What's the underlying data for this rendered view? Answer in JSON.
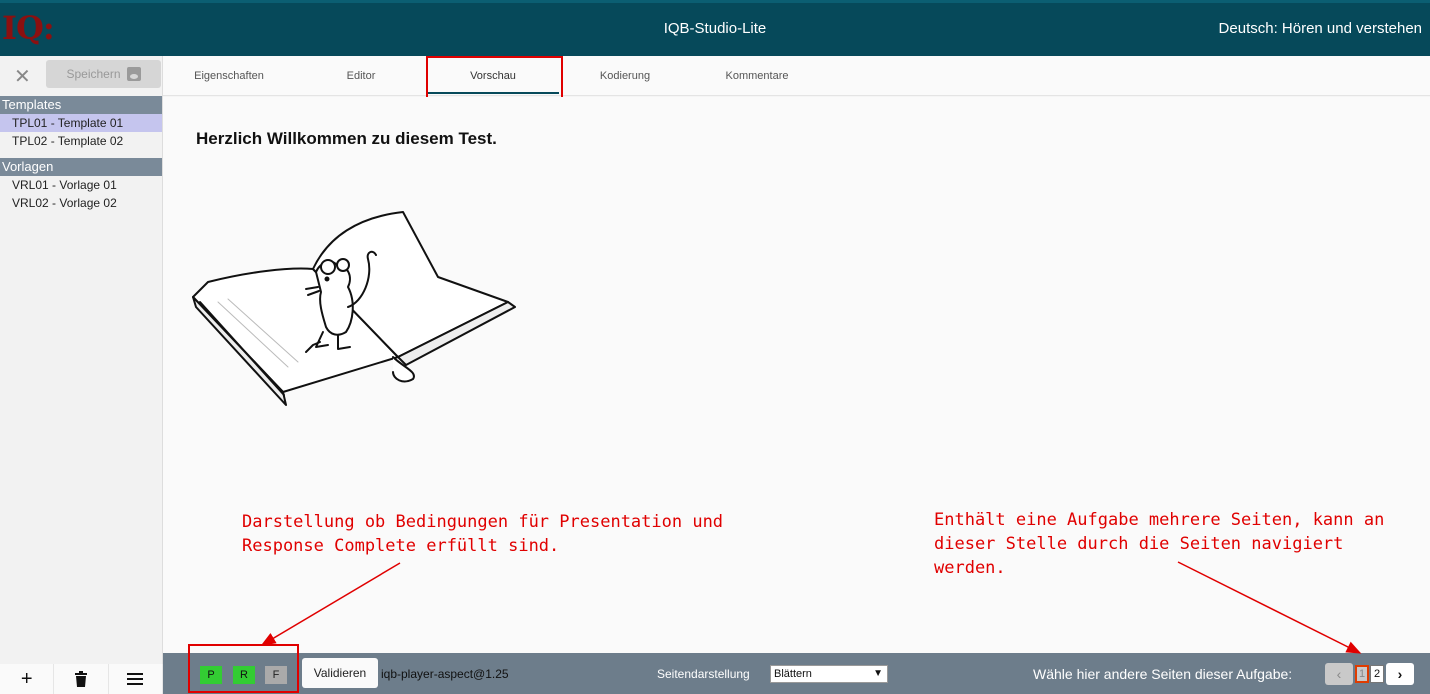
{
  "header": {
    "logo": "IQ:",
    "app_title": "IQB-Studio-Lite",
    "unit_title": "Deutsch: Hören und verstehen"
  },
  "sidebar": {
    "save_label": "Speichern",
    "groups": [
      {
        "title": "Templates",
        "items": [
          "TPL01 - Template 01",
          "TPL02 - Template 02"
        ]
      },
      {
        "title": "Vorlagen",
        "items": [
          "VRL01 - Vorlage 01",
          "VRL02 - Vorlage 02"
        ]
      }
    ],
    "selected_item": "TPL01 - Template 01"
  },
  "tabs": [
    "Eigenschaften",
    "Editor",
    "Vorschau",
    "Kodierung",
    "Kommentare"
  ],
  "active_tab": "Vorschau",
  "content": {
    "welcome_text": "Herzlich Willkommen zu diesem Test."
  },
  "annotations": {
    "status_note": "Darstellung ob Bedingungen für Presentation und Response Complete erfüllt sind.",
    "pages_note": "Enthält eine Aufgabe mehrere Seiten, kann an dieser Stelle durch die Seiten navigiert werden."
  },
  "bottom_bar": {
    "status": {
      "p": "P",
      "r": "R",
      "f": "F"
    },
    "validate_label": "Validieren",
    "player_version": "iqb-player-aspect@1.25",
    "page_mode_label": "Seitendarstellung",
    "page_mode_value": "Blättern",
    "pages_label": "Wähle hier andere Seiten dieser Aufgabe:",
    "pages": [
      "1",
      "2"
    ]
  },
  "colors": {
    "header_bg": "#06495a",
    "annotation_red": "#e00000",
    "status_green": "#33cc33"
  }
}
